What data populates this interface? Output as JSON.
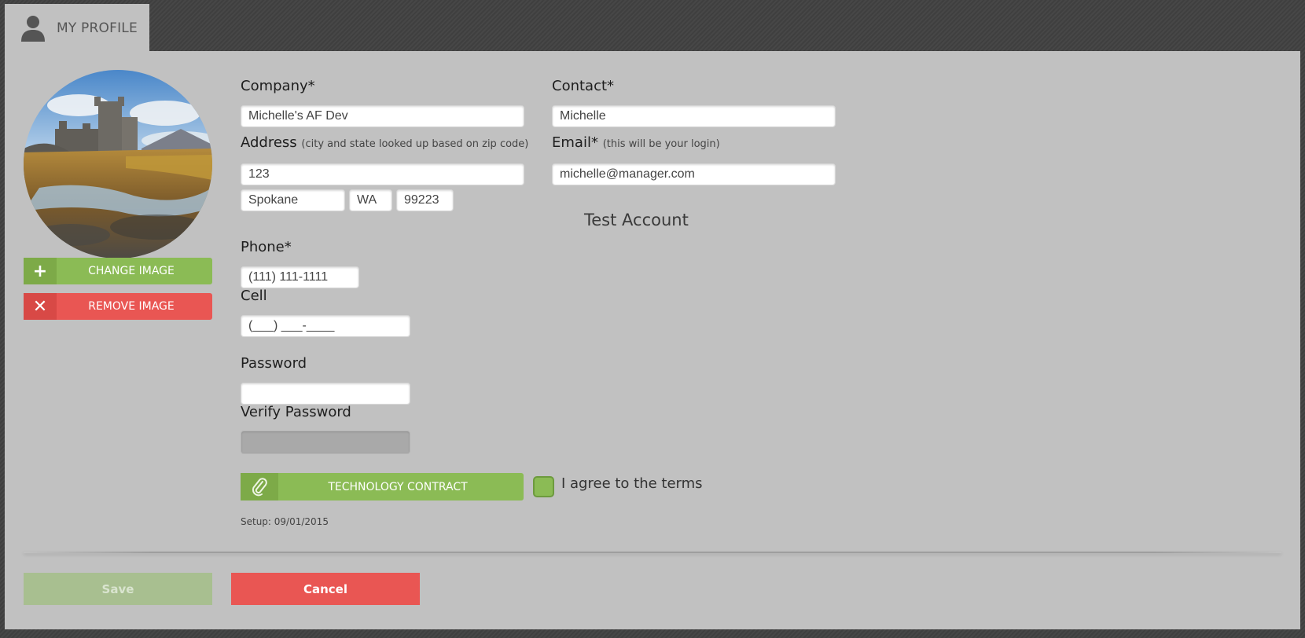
{
  "tab": {
    "title": "MY PROFILE",
    "icon": "user-icon"
  },
  "profile_image": {
    "change_label": "CHANGE IMAGE",
    "remove_label": "REMOVE IMAGE"
  },
  "form": {
    "company": {
      "label": "Company*",
      "value": "Michelle's AF Dev"
    },
    "contact": {
      "label": "Contact*",
      "value": "Michelle"
    },
    "address": {
      "label": "Address",
      "hint": "(city and state looked up based on zip code)",
      "line1": "123",
      "city": "Spokane",
      "state": "WA",
      "zip": "99223"
    },
    "email": {
      "label": "Email*",
      "hint": "(this will be your login)",
      "value": "michelle@manager.com"
    },
    "account_type": "Test Account",
    "phone": {
      "label": "Phone*",
      "value": "(111) 111-1111"
    },
    "cell": {
      "label": "Cell",
      "value": "(___) ___-____"
    },
    "password": {
      "label": "Password",
      "value": ""
    },
    "verify_password": {
      "label": "Verify Password",
      "value": ""
    },
    "contract_button": "TECHNOLOGY CONTRACT",
    "agree_label": "I agree to the terms",
    "agree_checked": false,
    "setup": "Setup: 09/01/2015"
  },
  "footer": {
    "save_label": "Save",
    "cancel_label": "Cancel"
  },
  "colors": {
    "accent_green": "#8bbb55",
    "danger_red": "#e95653",
    "panel_bg": "#c1c1c1"
  }
}
